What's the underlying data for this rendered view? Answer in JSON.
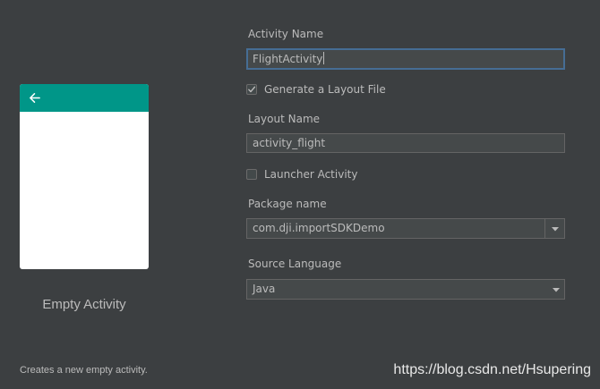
{
  "preview": {
    "appbar_color": "#009688",
    "back_icon": "arrow-left-icon",
    "template_name": "Empty Activity",
    "description": "Creates a new empty activity."
  },
  "form": {
    "activity_name": {
      "label": "Activity Name",
      "value": "FlightActivity"
    },
    "generate_layout": {
      "label": "Generate a Layout File",
      "checked": true
    },
    "layout_name": {
      "label": "Layout Name",
      "value": "activity_flight"
    },
    "launcher_activity": {
      "label": "Launcher Activity",
      "checked": false
    },
    "package_name": {
      "label": "Package name",
      "value": "com.dji.importSDKDemo"
    },
    "source_language": {
      "label": "Source Language",
      "value": "Java"
    }
  },
  "watermark": "https://blog.csdn.net/Hsupering",
  "colors": {
    "background": "#3c3f41",
    "field_background": "#45494a",
    "focus_border": "#466d94",
    "text": "#bbbbbb"
  }
}
